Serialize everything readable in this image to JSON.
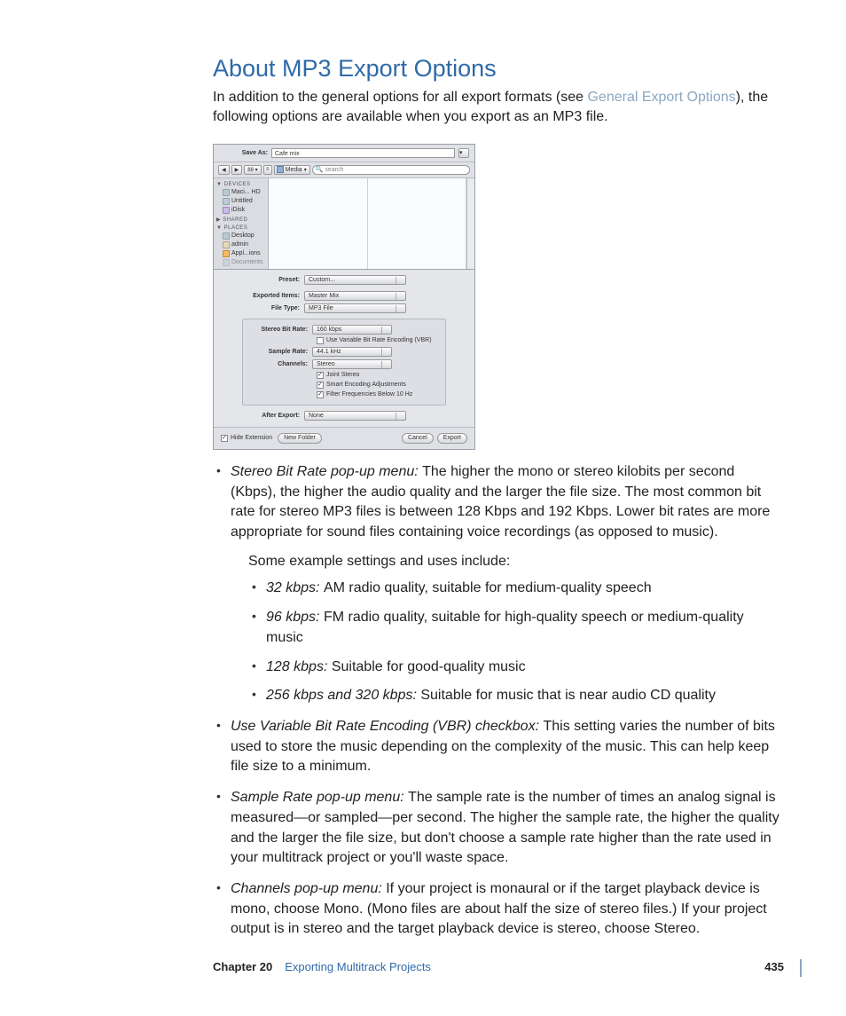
{
  "title": "About MP3 Export Options",
  "intro_pre": "In addition to the general options for all export formats (see ",
  "intro_link": "General Export Options",
  "intro_post": "), the following options are available when you export as an MP3 file.",
  "dialog": {
    "save_as_label": "Save As:",
    "save_as_value": "Cafe mix",
    "nav_back": "◀",
    "nav_fwd": "▶",
    "view_label": "88 ▾",
    "path_label": "Media",
    "search_placeholder": "search",
    "sidebar": {
      "devices_head": "▼ DEVICES",
      "dev_items": [
        "Maci... HD",
        "Untitled",
        "iDisk"
      ],
      "shared_head": "▶ SHARED",
      "places_head": "▼ PLACES",
      "place_items": [
        "Desktop",
        "admin",
        "Appl...ions",
        "Documents"
      ]
    },
    "preset_label": "Preset:",
    "preset_value": "Custom...",
    "exported_label": "Exported Items:",
    "exported_value": "Master Mix",
    "filetype_label": "File Type:",
    "filetype_value": "MP3 File",
    "bitrate_label": "Stereo Bit Rate:",
    "bitrate_value": "160 kbps",
    "vbr_label": "Use Variable Bit Rate Encoding (VBR)",
    "samplerate_label": "Sample Rate:",
    "samplerate_value": "44.1 kHz",
    "channels_label": "Channels:",
    "channels_value": "Stereo",
    "joint_label": "Joint Stereo",
    "smart_label": "Smart Encoding Adjustments",
    "filter_label": "Filter Frequencies Below 10 Hz",
    "after_label": "After Export:",
    "after_value": "None",
    "hide_ext": "Hide Extension",
    "new_folder": "New Folder",
    "cancel": "Cancel",
    "export": "Export"
  },
  "bullets": [
    {
      "term": "Stereo Bit Rate pop-up menu:  ",
      "text": "The higher the mono or stereo kilobits per second (Kbps), the higher the audio quality and the larger the file size. The most common bit rate for stereo MP3 files is between 128 Kbps and 192 Kbps. Lower bit rates are more appropriate for sound files containing voice recordings (as opposed to music).",
      "followup": "Some example settings and uses include:",
      "sub": [
        {
          "term": "32 kbps:  ",
          "text": "AM radio quality, suitable for medium-quality speech"
        },
        {
          "term": "96 kbps:  ",
          "text": "FM radio quality, suitable for high-quality speech or medium-quality music"
        },
        {
          "term": "128 kbps:  ",
          "text": "Suitable for good-quality music"
        },
        {
          "term": "256 kbps and 320 kbps:  ",
          "text": "Suitable for music that is near audio CD quality"
        }
      ]
    },
    {
      "term": "Use Variable Bit Rate Encoding (VBR) checkbox:  ",
      "text": "This setting varies the number of bits used to store the music depending on the complexity of the music. This can help keep file size to a minimum."
    },
    {
      "term": "Sample Rate pop-up menu:  ",
      "text": "The sample rate is the number of times an analog signal is measured—or sampled—per second. The higher the sample rate, the higher the quality and the larger the file size, but don't choose a sample rate higher than the rate used in your multitrack project or you'll waste space."
    },
    {
      "term": "Channels pop-up menu:  ",
      "text": "If your project is monaural or if the target playback device is mono, choose Mono. (Mono files are about half the size of stereo files.) If your project output is in stereo and the target playback device is stereo, choose Stereo."
    }
  ],
  "footer": {
    "chapter": "Chapter 20",
    "chapter_title": "Exporting Multitrack Projects",
    "page": "435"
  }
}
